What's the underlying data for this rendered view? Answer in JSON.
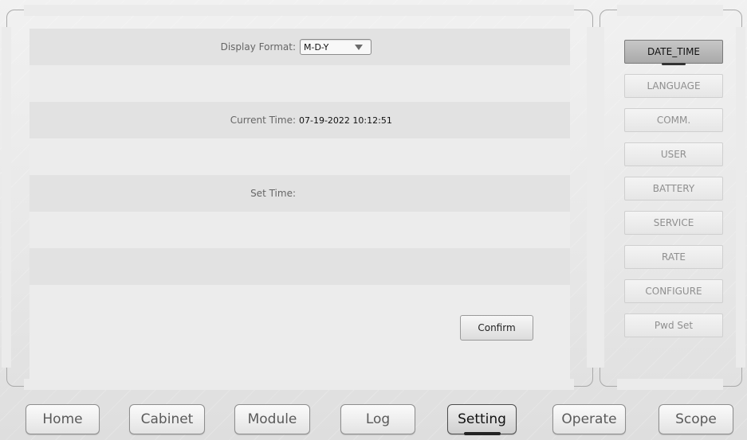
{
  "settings": {
    "display_format_label": "Display Format:",
    "display_format_value": "M-D-Y",
    "current_time_label": "Current Time:",
    "current_time_value": "07-19-2022 10:12:51",
    "set_time_label": "Set Time:",
    "confirm_label": "Confirm"
  },
  "side_menu": {
    "items": [
      {
        "label": "DATE_TIME",
        "active": true
      },
      {
        "label": "LANGUAGE",
        "active": false
      },
      {
        "label": "COMM.",
        "active": false
      },
      {
        "label": "USER",
        "active": false
      },
      {
        "label": "BATTERY",
        "active": false
      },
      {
        "label": "SERVICE",
        "active": false
      },
      {
        "label": "RATE",
        "active": false
      },
      {
        "label": "CONFIGURE",
        "active": false
      },
      {
        "label": "Pwd Set",
        "active": false
      }
    ]
  },
  "bottom_nav": {
    "items": [
      {
        "label": "Home",
        "active": false
      },
      {
        "label": "Cabinet",
        "active": false
      },
      {
        "label": "Module",
        "active": false
      },
      {
        "label": "Log",
        "active": false
      },
      {
        "label": "Setting",
        "active": true
      },
      {
        "label": "Operate",
        "active": false
      },
      {
        "label": "Scope",
        "active": false
      }
    ]
  },
  "colors": {
    "active_button": "#b9b9b9",
    "panel_background": "#ececec",
    "shaded_row": "#e2e2e2"
  }
}
